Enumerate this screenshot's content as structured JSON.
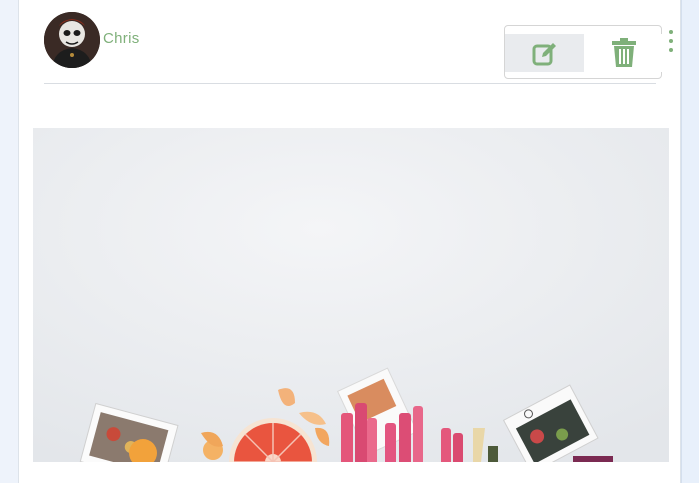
{
  "post": {
    "author": {
      "name": "Chris",
      "avatar_icon": "avatar-skull-facepaint"
    },
    "actions": {
      "edit_icon": "edit-icon",
      "delete_icon": "trash-icon",
      "more_icon": "kebab-menu-icon"
    },
    "image": {
      "subject": "fruit-and-rhubarb-flatlay"
    }
  },
  "colors": {
    "accent": "#7fb07a",
    "edit_background": "#e9ebee",
    "card_background": "#ffffff",
    "page_background": "#eef3fb"
  }
}
